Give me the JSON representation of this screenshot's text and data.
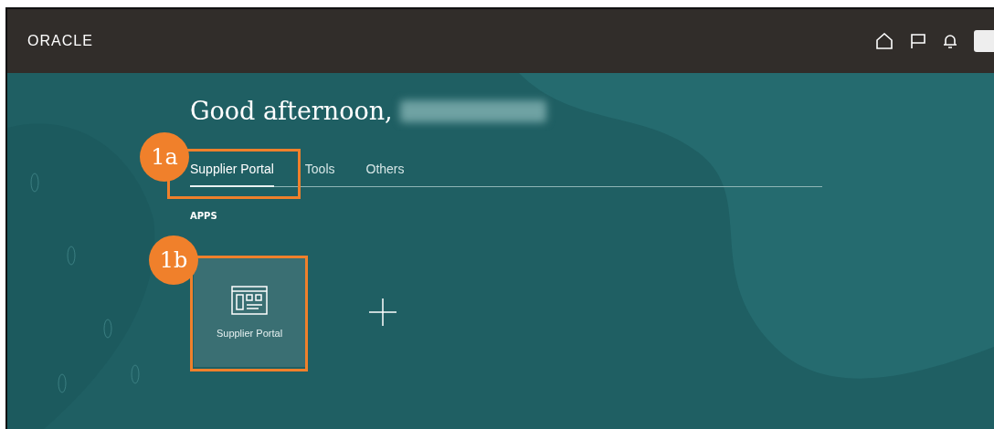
{
  "header": {
    "logo": "ORACLE"
  },
  "greeting": {
    "text": "Good afternoon,",
    "name_redacted": true
  },
  "tabs": [
    {
      "label": "Supplier Portal",
      "selected": true
    },
    {
      "label": "Tools",
      "selected": false
    },
    {
      "label": "Others",
      "selected": false
    }
  ],
  "apps": {
    "heading": "APPS",
    "items": [
      {
        "label": "Supplier Portal"
      }
    ]
  },
  "callouts": [
    {
      "label": "1a"
    },
    {
      "label": "1b"
    }
  ]
}
